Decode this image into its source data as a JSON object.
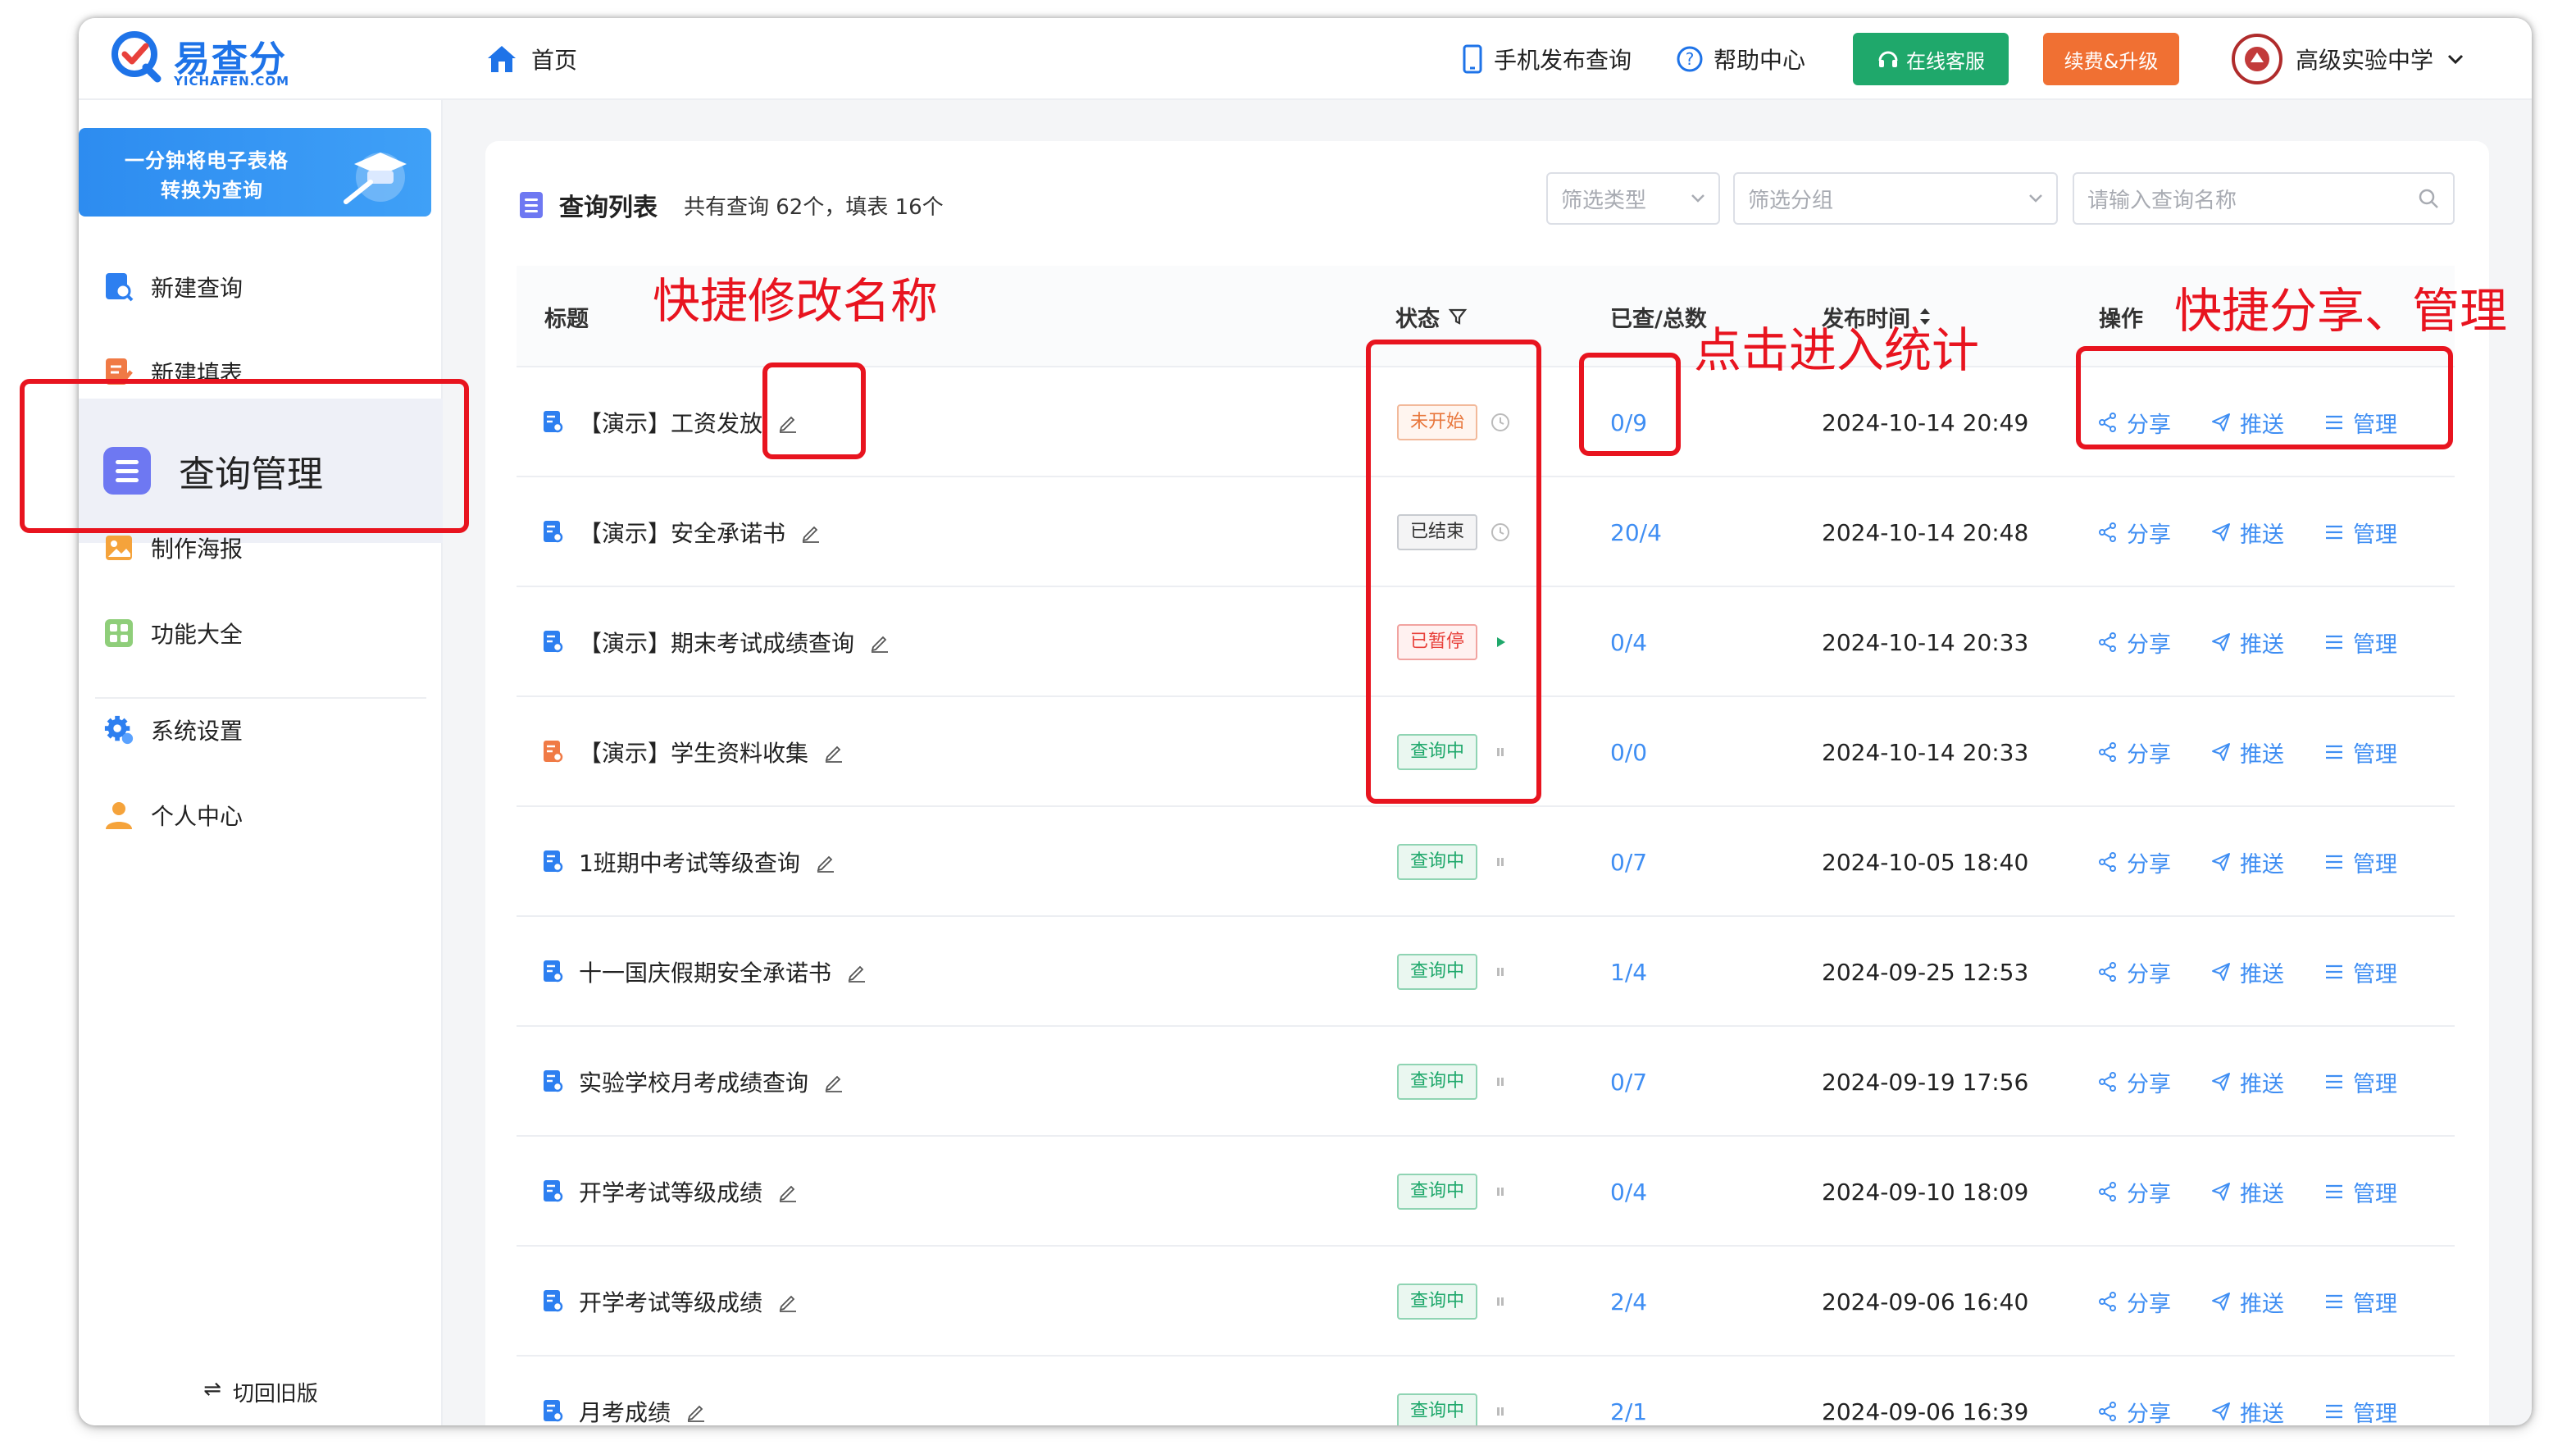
{
  "header": {
    "logo_text": "易查分",
    "logo_sub": "YICHAFEN.COM",
    "home_label": "首页",
    "mobile_label": "手机发布查询",
    "help_label": "帮助中心",
    "service_label": "在线客服",
    "renew_label": "续费&升级",
    "school_name": "高级实验中学"
  },
  "sidebar": {
    "promo_line1": "一分钟将电子表格",
    "promo_line2": "转换为查询",
    "items": [
      {
        "label": "新建查询"
      },
      {
        "label": "新建填表"
      },
      {
        "label": "查询管理"
      },
      {
        "label": "制作海报"
      },
      {
        "label": "功能大全"
      },
      {
        "label": "系统设置"
      },
      {
        "label": "个人中心"
      }
    ],
    "switch_label": "切回旧版"
  },
  "list": {
    "title": "查询列表",
    "summary": "共有查询 62个，填表 16个",
    "filter_type": "筛选类型",
    "filter_group": "筛选分组",
    "search_placeholder": "请输入查询名称"
  },
  "columns": {
    "title": "标题",
    "status": "状态",
    "count": "已查/总数",
    "time": "发布时间",
    "ops": "操作"
  },
  "ops_labels": {
    "share": "分享",
    "push": "推送",
    "manage": "管理"
  },
  "rows": [
    {
      "title": "【演示】工资发放",
      "status": "未开始",
      "count": "0/9",
      "time": "2024-10-14 20:49"
    },
    {
      "title": "【演示】安全承诺书",
      "status": "已结束",
      "count": "20/4",
      "time": "2024-10-14 20:48"
    },
    {
      "title": "【演示】期末考试成绩查询",
      "status": "已暂停",
      "count": "0/4",
      "time": "2024-10-14 20:33"
    },
    {
      "title": "【演示】学生资料收集",
      "status": "查询中",
      "count": "0/0",
      "time": "2024-10-14 20:33"
    },
    {
      "title": "1班期中考试等级查询",
      "status": "查询中",
      "count": "0/7",
      "time": "2024-10-05 18:40"
    },
    {
      "title": "十一国庆假期安全承诺书",
      "status": "查询中",
      "count": "1/4",
      "time": "2024-09-25 12:53"
    },
    {
      "title": "实验学校月考成绩查询",
      "status": "查询中",
      "count": "0/7",
      "time": "2024-09-19 17:56"
    },
    {
      "title": "开学考试等级成绩",
      "status": "查询中",
      "count": "0/4",
      "time": "2024-09-10 18:09"
    },
    {
      "title": "开学考试等级成绩",
      "status": "查询中",
      "count": "2/4",
      "time": "2024-09-06 16:40"
    },
    {
      "title": "月考成绩",
      "status": "查询中",
      "count": "2/1",
      "time": "2024-09-06 16:39"
    }
  ],
  "annotations": {
    "rename": "快捷修改名称",
    "stats": "点击进入统计",
    "share_manage": "快捷分享、管理"
  },
  "colors": {
    "brand_blue": "#1e73e8",
    "link_blue": "#3f8ef3",
    "green": "#1fa86b",
    "orange": "#f07033",
    "annotation_red": "#e8141f"
  }
}
